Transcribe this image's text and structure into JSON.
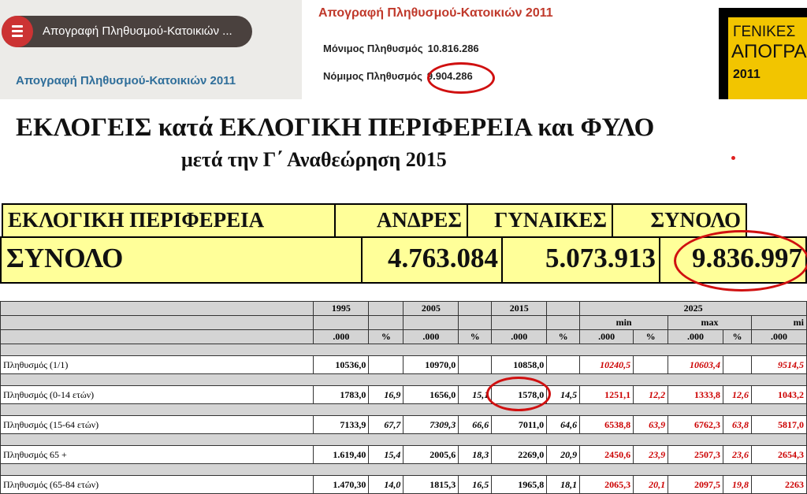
{
  "left_panel": {
    "menu_label": "Απογραφή Πληθυσμού-Κατοικιών ...",
    "title": "Απογραφή Πληθυσμού-Κατοικιών 2011"
  },
  "census": {
    "title": "Απογραφή Πληθυσμού-Κατοικιών 2011",
    "permanent_label": "Μόνιμος Πληθυσμός",
    "permanent_value": "10.816.286",
    "legal_label": "Νόμιμος Πληθυσμός",
    "legal_value": "9.904.286"
  },
  "logo": {
    "line1": "ΓΕΝΙΚΕΣ",
    "line2": "ΑΠΟΓΡΑ",
    "line3": "2011"
  },
  "heading": {
    "line1": "ΕΚΛΟΓΕΙΣ κατά ΕΚΛΟΓΙΚΗ ΠΕΡΙΦΕΡΕΙΑ και ΦΥΛΟ",
    "line2": "μετά την Γ΄ Αναθεώρηση 2015"
  },
  "summary": {
    "headers": [
      "ΕΚΛΟΓΙΚΗ ΠΕΡΙΦΕΡΕΙΑ",
      "ΑΝΔΡΕΣ",
      "ΓΥΝΑΙΚΕΣ",
      "ΣΥΝΟΛΟ"
    ],
    "row_label": "ΣΥΝΟΛΟ",
    "men": "4.763.084",
    "women": "5.073.913",
    "total": "9.836.997"
  },
  "table": {
    "years": [
      "1995",
      "2005",
      "2015",
      "2025"
    ],
    "sub": [
      "min",
      "max"
    ],
    "last_sub": "mi",
    "units": [
      ".000",
      "%",
      ".000",
      "%",
      ".000",
      "%",
      ".000",
      "%",
      ".000",
      "%",
      ".000"
    ],
    "rows": [
      {
        "label": "Πληθυσμός (1/1)",
        "cells": [
          "10536,0",
          "",
          "10970,0",
          "",
          "10858,0",
          "",
          "10240,5",
          "",
          "10603,4",
          "",
          "9514,5"
        ]
      },
      {
        "label": "Πληθυσμός (0-14 ετών)",
        "cells": [
          "1783,0",
          "16,9",
          "1656,0",
          "15,1",
          "1578,0",
          "14,5",
          "1251,1",
          "12,2",
          "1333,8",
          "12,6",
          "1043,2"
        ]
      },
      {
        "label": "Πληθυσμός (15-64 ετών)",
        "cells": [
          "7133,9",
          "67,7",
          "7309,3",
          "66,6",
          "7011,0",
          "64,6",
          "6538,8",
          "63,9",
          "6762,3",
          "63,8",
          "5817,0"
        ]
      },
      {
        "label": "Πληθυσμός 65 +",
        "cells": [
          "1.619,40",
          "15,4",
          "2005,6",
          "18,3",
          "2269,0",
          "20,9",
          "2450,6",
          "23,9",
          "2507,3",
          "23,6",
          "2654,3"
        ]
      },
      {
        "label": "Πληθυσμός (65-84 ετών)",
        "cells": [
          "1.470,30",
          "14,0",
          "1815,3",
          "16,5",
          "1965,8",
          "18,1",
          "2065,3",
          "20,1",
          "2097,5",
          "19,8",
          "2263"
        ]
      }
    ]
  }
}
